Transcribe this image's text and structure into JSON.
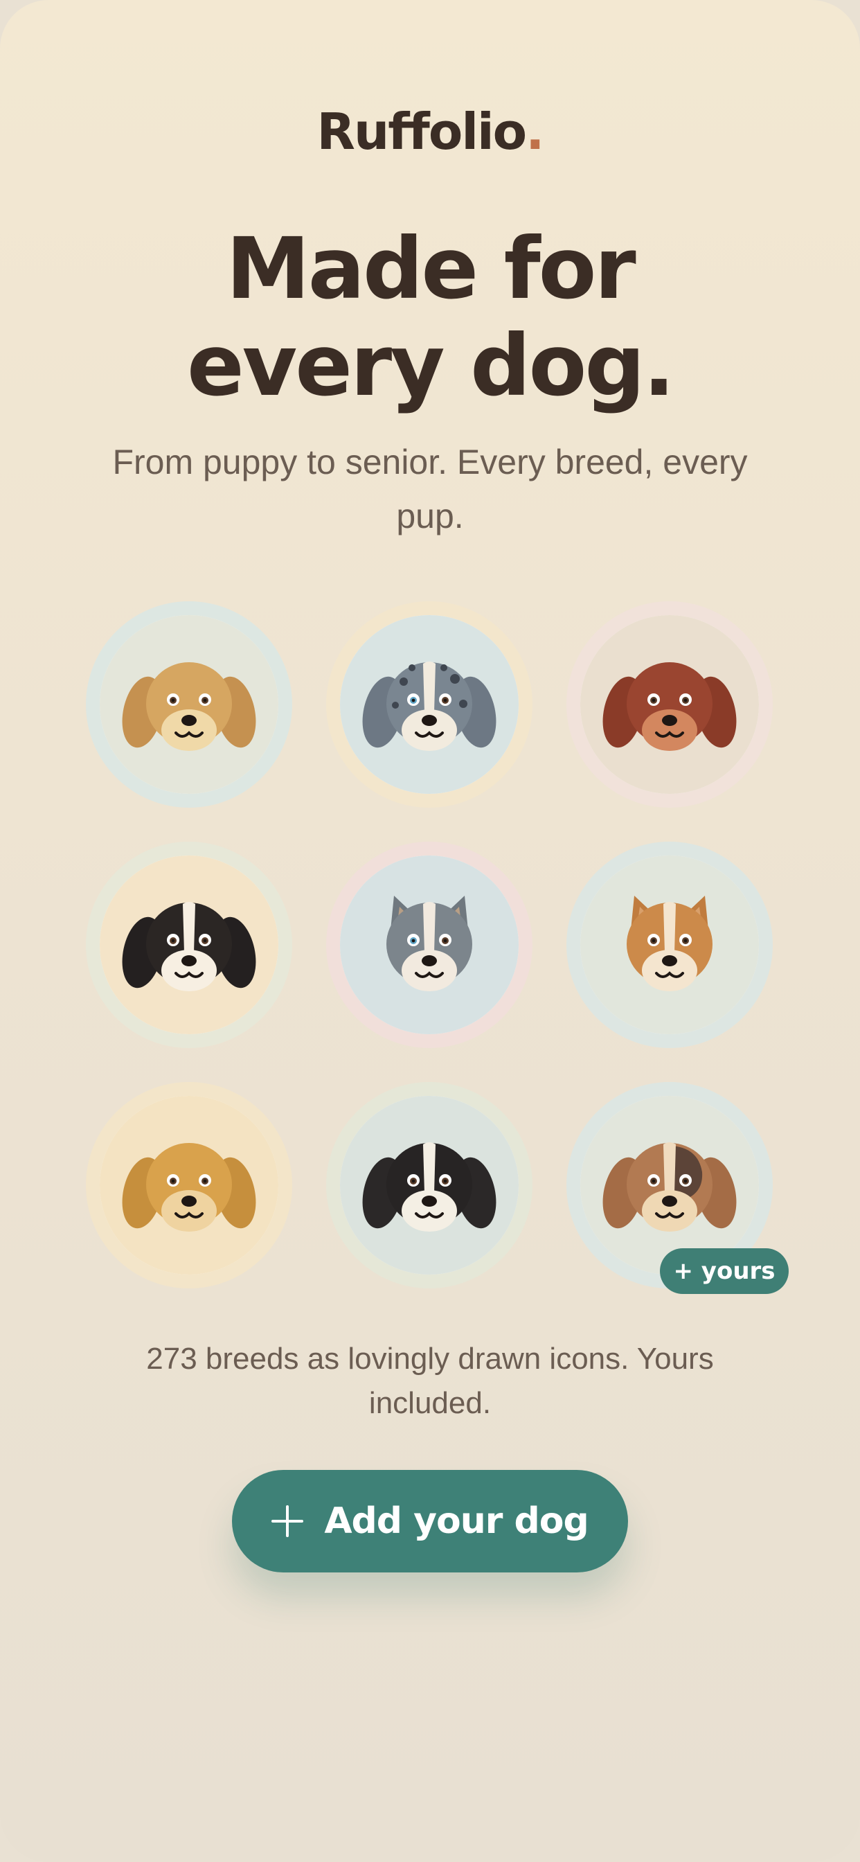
{
  "brand": {
    "name": "Ruffolio",
    "dot": "."
  },
  "hero": {
    "title_line1": "Made for",
    "title_line2": "every dog.",
    "subtitle": "From puppy to senior. Every breed, every pup."
  },
  "avatars": [
    {
      "icon": "golden-puppy-icon",
      "ring": "#dde7e2",
      "bg": "#e4e6da",
      "fur": "#d6a661",
      "ear": "#c59150",
      "muzzle": "#f0d9a8",
      "blaze": ""
    },
    {
      "icon": "merle-shepherd-icon",
      "ring": "#f3e6cc",
      "bg": "#d9e4e3",
      "fur": "#7a8691",
      "ear": "#6d7884",
      "muzzle": "#f2ebde",
      "blaze": "#f2ebde"
    },
    {
      "icon": "setter-icon",
      "ring": "#f1e2da",
      "bg": "#eadfcf",
      "fur": "#9a4530",
      "ear": "#8a3b28",
      "muzzle": "#d3875f",
      "blaze": ""
    },
    {
      "icon": "bernese-icon",
      "ring": "#e7e8d8",
      "bg": "#f4e4c8",
      "fur": "#2b2624",
      "ear": "#242020",
      "muzzle": "#f7efe2",
      "blaze": "#f7efe2"
    },
    {
      "icon": "husky-icon",
      "ring": "#f1dfda",
      "bg": "#d7e2e3",
      "fur": "#7c858c",
      "ear": "#6f787f",
      "muzzle": "#f2eadf",
      "blaze": "#f2eadf"
    },
    {
      "icon": "corgi-icon",
      "ring": "#dde6e2",
      "bg": "#e1e6dc",
      "fur": "#cc8a4a",
      "ear": "#c07c3e",
      "muzzle": "#f4e5cf",
      "blaze": "#f4e5cf"
    },
    {
      "icon": "labrador-icon",
      "ring": "#f3e5c9",
      "bg": "#f4e3c2",
      "fur": "#d9a24c",
      "ear": "#c68f3d",
      "muzzle": "#efd3a0",
      "blaze": ""
    },
    {
      "icon": "border-collie-icon",
      "ring": "#e5e7d7",
      "bg": "#dbe3de",
      "fur": "#272424",
      "ear": "#2b2828",
      "muzzle": "#f4efe4",
      "blaze": "#f4efe4"
    },
    {
      "icon": "beagle-icon",
      "ring": "#dde6e2",
      "bg": "#e2e6dc",
      "fur": "#b27a52",
      "ear": "#a46c46",
      "muzzle": "#efd8b4",
      "blaze": "#f0dcc0"
    }
  ],
  "badge": {
    "yours": "+ yours"
  },
  "caption": "273 breeds as lovingly drawn icons. Yours included.",
  "cta": {
    "label": "Add your dog",
    "icon": "plus-icon"
  },
  "colors": {
    "accent": "#3e8177",
    "text": "#3b2d25",
    "muted": "#6b5d52",
    "brand_dot": "#c0714a"
  }
}
